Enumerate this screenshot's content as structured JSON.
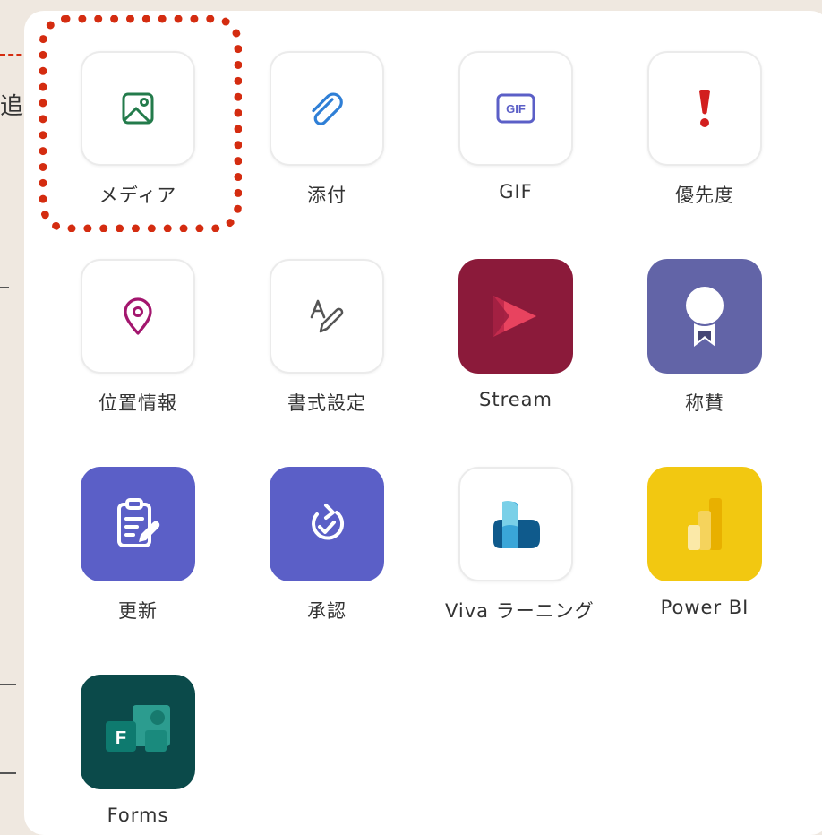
{
  "attach_menu": {
    "items": [
      {
        "label": "メディア",
        "icon": "image-icon"
      },
      {
        "label": "添付",
        "icon": "paperclip-icon"
      },
      {
        "label": "GIF",
        "icon": "gif-icon",
        "icon_text": "GIF"
      },
      {
        "label": "優先度",
        "icon": "exclamation-icon"
      },
      {
        "label": "位置情報",
        "icon": "location-pin-icon"
      },
      {
        "label": "書式設定",
        "icon": "format-text-icon"
      },
      {
        "label": "Stream",
        "icon": "stream-app-icon",
        "color": "#8b1a3a"
      },
      {
        "label": "称賛",
        "icon": "praise-badge-icon",
        "color": "#6264a7"
      },
      {
        "label": "更新",
        "icon": "updates-clipboard-icon",
        "color": "#5b5fc7"
      },
      {
        "label": "承認",
        "icon": "approvals-icon",
        "color": "#5b5fc7"
      },
      {
        "label": "Viva ラーニング",
        "icon": "viva-learning-icon"
      },
      {
        "label": "Power BI",
        "icon": "power-bi-icon",
        "color": "#f2c811"
      },
      {
        "label": "Forms",
        "icon": "forms-app-icon",
        "color": "#0b4a4a",
        "icon_text": "F"
      }
    ]
  },
  "background": {
    "partial_glyph": "追"
  },
  "highlight": {
    "target": "メディア",
    "color": "#d42c10"
  }
}
